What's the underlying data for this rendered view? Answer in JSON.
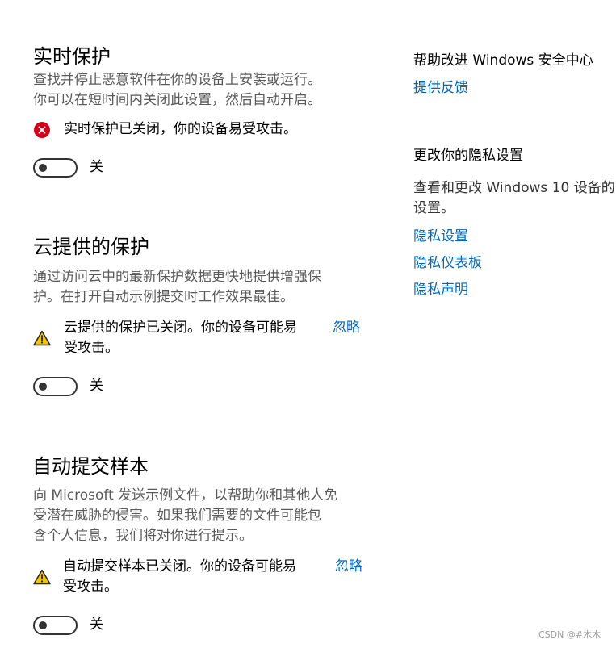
{
  "realtime": {
    "title": "实时保护",
    "desc_line1": "查找并停止恶意软件在你的设备上安装或运行。",
    "desc_line2": "你可以在短时间内关闭此设置，然后自动开启。",
    "status": "实时保护已关闭，你的设备易受攻击。",
    "status_icon": "error-circle-icon",
    "toggle_label": "关",
    "toggle_on": false
  },
  "cloud": {
    "title": "云提供的保护",
    "desc_line1": "通过访问云中的最新保护数据更快地提供增强保",
    "desc_line2": "护。在打开自动示例提交时工作效果最佳。",
    "status_line1": "云提供的保护已关闭。你的设备可能易",
    "status_line2": "受攻击。",
    "status_icon": "warning-icon",
    "dismiss": "忽略",
    "toggle_label": "关",
    "toggle_on": false
  },
  "sample": {
    "title": "自动提交样本",
    "desc_line1": "向 Microsoft 发送示例文件，以帮助你和其他人免",
    "desc_line2": "受潜在威胁的侵害。如果我们需要的文件可能包",
    "desc_line3": "含个人信息，我们将对你进行提示。",
    "status_line1": "自动提交样本已关闭。你的设备可能易",
    "status_line2": "受攻击。",
    "status_icon": "warning-icon",
    "dismiss": "忽略",
    "toggle_label": "关",
    "toggle_on": false
  },
  "sidebar": {
    "help_heading": "帮助改进 Windows 安全中心",
    "feedback_link": "提供反馈",
    "privacy_heading": "更改你的隐私设置",
    "privacy_text_line1": "查看和更改 Windows 10 设备的",
    "privacy_text_line2": "设置。",
    "links": [
      "隐私设置",
      "隐私仪表板",
      "隐私声明"
    ]
  },
  "watermark": "CSDN @#木木",
  "colors": {
    "accent": "#0067b8",
    "error": "#d0021b",
    "warning": "#f5c400"
  }
}
